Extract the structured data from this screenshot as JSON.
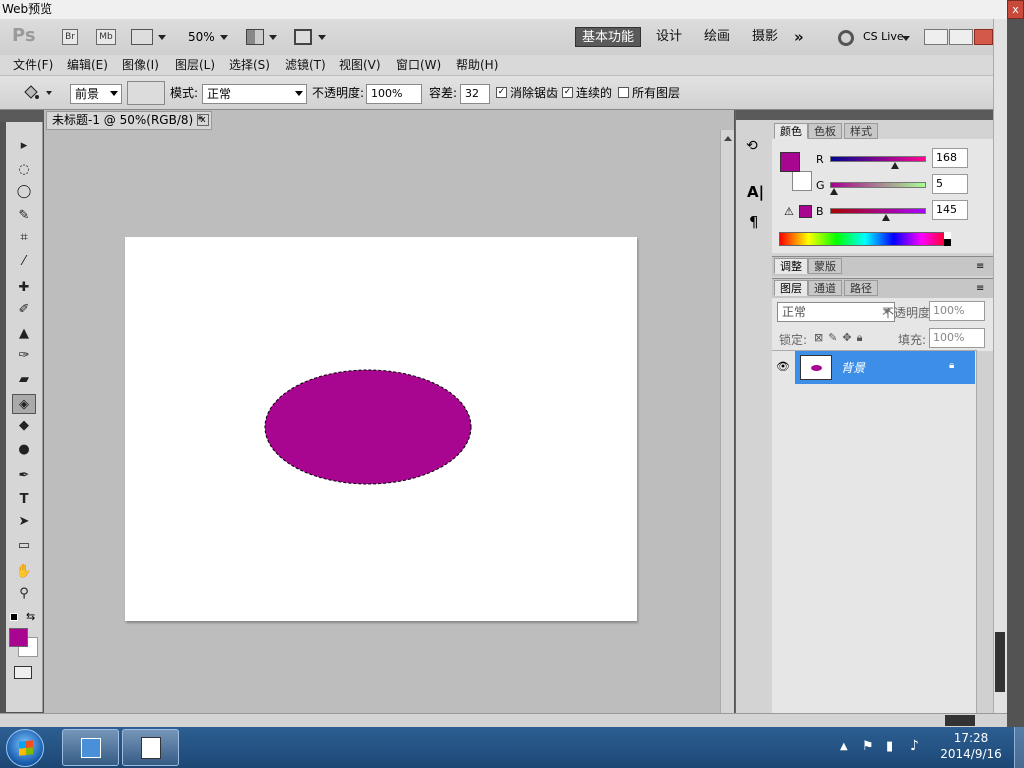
{
  "window": {
    "title": "Web预览",
    "close_glyph": "x"
  },
  "appbar": {
    "logo": "Ps",
    "icons": [
      "Br",
      "Mb"
    ],
    "zoom": "50%",
    "workspaces": [
      "基本功能",
      "设计",
      "绘画",
      "摄影"
    ],
    "more": "»",
    "cslive": "CS Live"
  },
  "menu": [
    "文件(F)",
    "编辑(E)",
    "图像(I)",
    "图层(L)",
    "选择(S)",
    "滤镜(T)",
    "视图(V)",
    "窗口(W)",
    "帮助(H)"
  ],
  "options": {
    "fill_source": "前景",
    "mode_label": "模式:",
    "mode_value": "正常",
    "opacity_label": "不透明度:",
    "opacity_value": "100%",
    "tolerance_label": "容差:",
    "tolerance_value": "32",
    "antialias_label": "消除锯齿",
    "antialias_checked": "✓",
    "contiguous_label": "连续的",
    "contiguous_checked": "✓",
    "all_layers_label": "所有图层"
  },
  "document": {
    "tab_title": "未标题-1 @ 50%(RGB/8) *",
    "close": "x"
  },
  "color_panel": {
    "tabs": [
      "颜色",
      "色板",
      "样式"
    ],
    "r_label": "R",
    "g_label": "G",
    "b_label": "B",
    "r": "168",
    "g": "5",
    "b": "145",
    "foreground": "#a80591"
  },
  "adjust_panel": {
    "tabs": [
      "调整",
      "蒙版"
    ]
  },
  "layers_panel": {
    "tabs": [
      "图层",
      "通道",
      "路径"
    ],
    "blend": "正常",
    "opacity_label": "不透明度:",
    "opacity_value": "100%",
    "lock_label": "锁定:",
    "fill_label": "填充:",
    "fill_value": "100%",
    "layer_name": "背景"
  },
  "taskbar": {
    "time": "17:28",
    "date": "2014/9/16"
  },
  "colors": {
    "accent": "#a80591",
    "layer_selected": "#3d8ee6"
  }
}
